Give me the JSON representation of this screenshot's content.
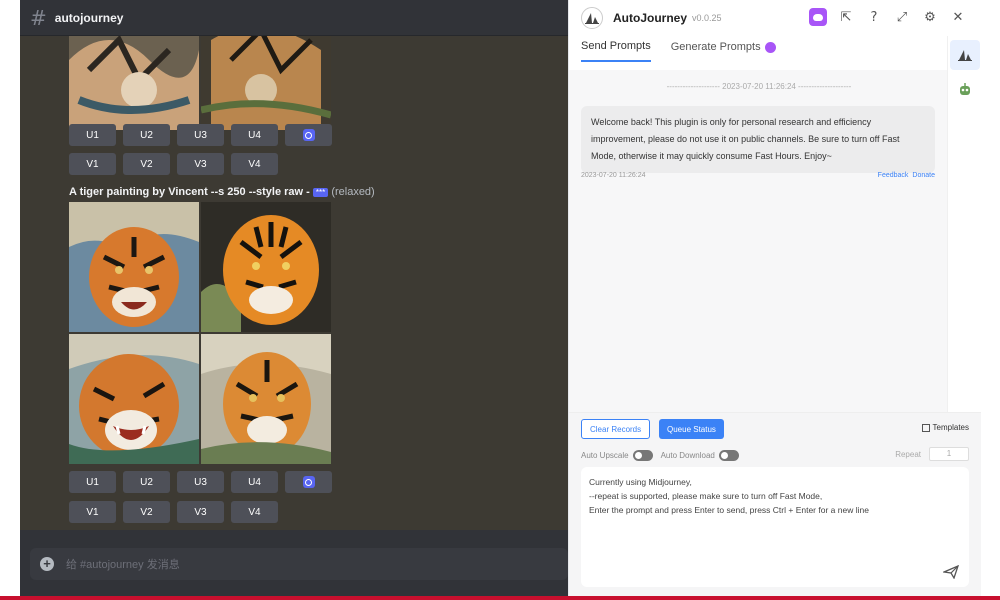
{
  "discord": {
    "channel_name": "autojourney",
    "caption_prompt": "A tiger painting by Vincent --s 250 --style raw -",
    "caption_tag": "***",
    "caption_status": "(relaxed)",
    "buttons_u": [
      "U1",
      "U2",
      "U3",
      "U4"
    ],
    "buttons_v": [
      "V1",
      "V2",
      "V3",
      "V4"
    ],
    "composer_placeholder": "给 #autojourney 发消息"
  },
  "plugin": {
    "title": "AutoJourney",
    "version": "v0.0.25",
    "tabs": [
      "Send Prompts",
      "Generate Prompts"
    ],
    "timestamp_line": "-------------------- 2023-07-20 11:26:24 --------------------",
    "welcome_message": "Welcome back! This plugin is only for personal research and efficiency improvement, please do not use it on public channels. Be sure to turn off Fast Mode, otherwise it may quickly consume Fast Hours. Enjoy~",
    "message_time": "2023-07-20 11:26:24",
    "feedback_label": "Feedback",
    "donate_label": "Donate",
    "clear_records_label": "Clear Records",
    "queue_status_label": "Queue Status",
    "templates_label": "Templates",
    "auto_upscale_label": "Auto Upscale",
    "auto_download_label": "Auto Download",
    "repeat_label": "Repeat",
    "repeat_value": "1",
    "prompt_line1": "Currently using Midjourney,",
    "prompt_line2": "--repeat is supported, please make sure to turn off Fast Mode,",
    "prompt_line3": "Enter the prompt and press Enter to send, press Ctrl + Enter for a new line"
  },
  "colors": {
    "accent_blue": "#3b82f6",
    "discord_blurple": "#5865f2",
    "purple": "#a855f7"
  }
}
